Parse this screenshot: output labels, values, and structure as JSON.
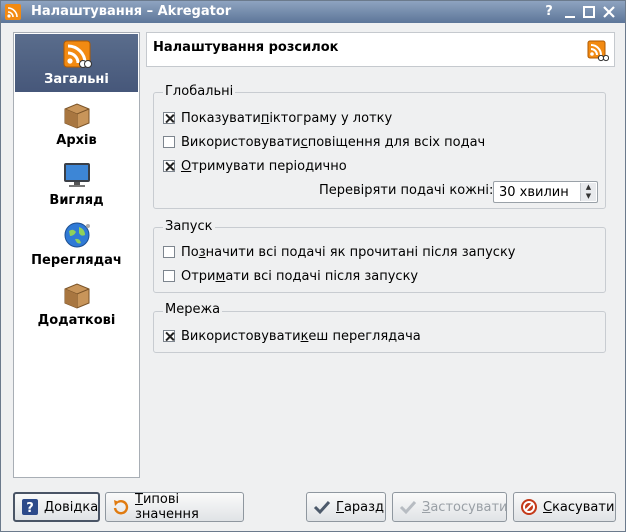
{
  "window": {
    "title": "Налаштування – Akregator",
    "help_glyph": "?"
  },
  "sidebar": {
    "items": [
      {
        "label": "Загальні",
        "icon": "rss-feed-icon",
        "active": true
      },
      {
        "label": "Архів",
        "icon": "archive-box-icon"
      },
      {
        "label": "Вигляд",
        "icon": "monitor-icon"
      },
      {
        "label": "Переглядач",
        "icon": "globe-icon"
      },
      {
        "label": "Додаткові",
        "icon": "package-box-icon"
      }
    ]
  },
  "header": {
    "title": "Налаштування розсилок",
    "icon": "rss-feed-icon"
  },
  "groups": {
    "global": {
      "title": "Глобальні",
      "show_tray": {
        "pre": "Показувати ",
        "u": "п",
        "post": "іктограму у лотку",
        "checked": true
      },
      "notify": {
        "pre": "Використовувати ",
        "u": "с",
        "post": "повіщення для всіх подач",
        "checked": false
      },
      "periodic": {
        "pre": "",
        "u": "О",
        "post": "тримувати періодично",
        "checked": true
      },
      "interval_label": "Перевіряти подачі кожні:",
      "interval_value": "30 хвилин"
    },
    "startup": {
      "title": "Запуск",
      "mark_read": {
        "pre": "По",
        "u": "з",
        "post": "начити всі подачі як прочитані після запуску",
        "checked": false
      },
      "fetch_all": {
        "pre": "Отри",
        "u": "м",
        "post": "ати всі подачі після запуску",
        "checked": false
      }
    },
    "network": {
      "title": "Мережа",
      "use_cache": {
        "pre": "Використовувати ",
        "u": "к",
        "post": "еш переглядача",
        "checked": true
      }
    }
  },
  "buttons": {
    "help": {
      "u": "Д",
      "rest": "овідка"
    },
    "defaults": {
      "u": "Т",
      "rest": "ипові значення"
    },
    "ok": {
      "u": "Г",
      "rest": "аразд"
    },
    "apply": {
      "u": "З",
      "rest": "астосувати",
      "disabled": true
    },
    "cancel": {
      "u": "С",
      "rest": "касувати"
    }
  },
  "colors": {
    "accent": "#4e6186",
    "rss": "#f28a12"
  }
}
